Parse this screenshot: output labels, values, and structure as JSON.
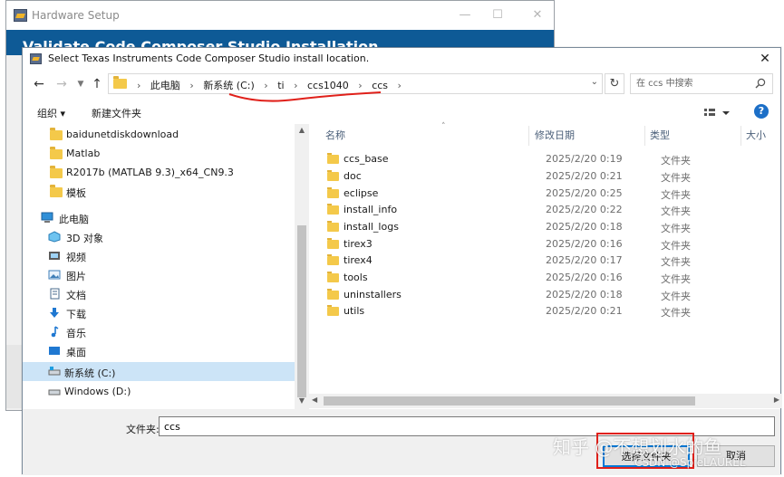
{
  "background_window": {
    "title": "Hardware Setup",
    "banner": "Validate Code Composer Studio Installation"
  },
  "dialog": {
    "title": "Select Texas Instruments Code Composer Studio install location.",
    "close_glyph": "✕",
    "address": {
      "breadcrumbs": [
        "此电脑",
        "新系统 (C:)",
        "ti",
        "ccs1040",
        "ccs"
      ]
    },
    "search": {
      "placeholder": "在 ccs 中搜索"
    },
    "commands": {
      "organize": "组织 ▾",
      "new_folder": "新建文件夹"
    },
    "help_glyph": "?",
    "nav_items": [
      {
        "label": "baidunetdiskdownload",
        "icon": "folder-icon"
      },
      {
        "label": "Matlab",
        "icon": "folder-icon"
      },
      {
        "label": "R2017b (MATLAB 9.3)_x64_CN9.3",
        "icon": "folder-icon"
      },
      {
        "label": "模板",
        "icon": "folder-icon"
      },
      {
        "label": "此电脑",
        "icon": "computer-icon"
      },
      {
        "label": "3D 对象",
        "icon": "3d-objects-icon"
      },
      {
        "label": "视频",
        "icon": "video-icon"
      },
      {
        "label": "图片",
        "icon": "pictures-icon"
      },
      {
        "label": "文档",
        "icon": "documents-icon"
      },
      {
        "label": "下载",
        "icon": "downloads-icon"
      },
      {
        "label": "音乐",
        "icon": "music-icon"
      },
      {
        "label": "桌面",
        "icon": "desktop-icon"
      },
      {
        "label": "新系统 (C:)",
        "icon": "drive-icon"
      },
      {
        "label": "Windows  (D:)",
        "icon": "drive-icon"
      }
    ],
    "columns": {
      "name": "名称",
      "date": "修改日期",
      "type": "类型",
      "size": "大小"
    },
    "files": [
      {
        "name": "ccs_base",
        "date": "2025/2/20 0:19",
        "type": "文件夹"
      },
      {
        "name": "doc",
        "date": "2025/2/20 0:21",
        "type": "文件夹"
      },
      {
        "name": "eclipse",
        "date": "2025/2/20 0:25",
        "type": "文件夹"
      },
      {
        "name": "install_info",
        "date": "2025/2/20 0:22",
        "type": "文件夹"
      },
      {
        "name": "install_logs",
        "date": "2025/2/20 0:18",
        "type": "文件夹"
      },
      {
        "name": "tirex3",
        "date": "2025/2/20 0:16",
        "type": "文件夹"
      },
      {
        "name": "tirex4",
        "date": "2025/2/20 0:17",
        "type": "文件夹"
      },
      {
        "name": "tools",
        "date": "2025/2/20 0:16",
        "type": "文件夹"
      },
      {
        "name": "uninstallers",
        "date": "2025/2/20 0:18",
        "type": "文件夹"
      },
      {
        "name": "utils",
        "date": "2025/2/20 0:21",
        "type": "文件夹"
      }
    ],
    "folder_field": {
      "label": "文件夹:",
      "value": "ccs"
    },
    "buttons": {
      "select": "选择文件夹",
      "cancel": "取消"
    }
  },
  "watermark": {
    "main": "知乎 @不想划水的鱼",
    "sub": "CSDN @SpieLAUREL"
  },
  "colors": {
    "banner": "#0e5a96",
    "accent": "#0078d7",
    "annotation_red": "#e0201a",
    "selected_nav": "#cce4f7"
  }
}
